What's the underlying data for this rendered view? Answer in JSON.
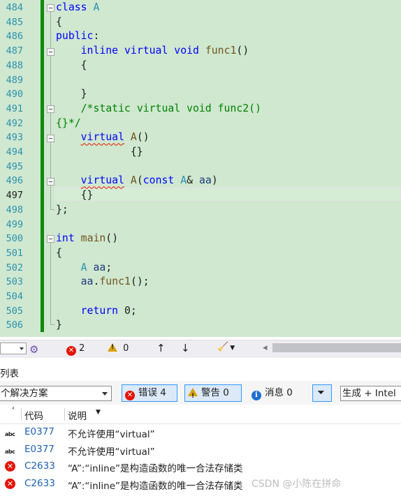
{
  "editor": {
    "line_numbers": [
      "484",
      "485",
      "486",
      "487",
      "488",
      "489",
      "490",
      "491",
      "492",
      "493",
      "494",
      "495",
      "496",
      "497",
      "498",
      "499",
      "500",
      "501",
      "502",
      "503",
      "504",
      "505",
      "506"
    ],
    "lines": [
      [
        {
          "t": "class",
          "c": "kw"
        },
        {
          "t": " "
        },
        {
          "t": "A",
          "c": "ty"
        }
      ],
      [
        {
          "t": "{"
        }
      ],
      [
        {
          "t": "public",
          "c": "kw"
        },
        {
          "t": ":"
        }
      ],
      [
        {
          "t": "    "
        },
        {
          "t": "inline",
          "c": "kw"
        },
        {
          "t": " "
        },
        {
          "t": "virtual",
          "c": "kw"
        },
        {
          "t": " "
        },
        {
          "t": "void",
          "c": "kw"
        },
        {
          "t": " "
        },
        {
          "t": "func1",
          "c": "fn"
        },
        {
          "t": "()"
        }
      ],
      [
        {
          "t": "    {"
        }
      ],
      [
        {
          "t": ""
        }
      ],
      [
        {
          "t": "    }"
        }
      ],
      [
        {
          "t": "    "
        },
        {
          "t": "/*static virtual void func2()",
          "c": "cm"
        }
      ],
      [
        {
          "t": "{}*/",
          "c": "cm"
        }
      ],
      [
        {
          "t": "    "
        },
        {
          "t": "virtual",
          "c": "kw squig"
        },
        {
          "t": " "
        },
        {
          "t": "A",
          "c": "fn"
        },
        {
          "t": "()"
        }
      ],
      [
        {
          "t": "            {}"
        }
      ],
      [
        {
          "t": ""
        }
      ],
      [
        {
          "t": "    "
        },
        {
          "t": "virtual",
          "c": "kw squig"
        },
        {
          "t": " "
        },
        {
          "t": "A",
          "c": "fn"
        },
        {
          "t": "("
        },
        {
          "t": "const",
          "c": "kw"
        },
        {
          "t": " "
        },
        {
          "t": "A",
          "c": "ty"
        },
        {
          "t": "& "
        },
        {
          "t": "aa",
          "c": "id"
        },
        {
          "t": ")"
        }
      ],
      [
        {
          "t": "    {}"
        }
      ],
      [
        {
          "t": "};"
        }
      ],
      [
        {
          "t": ""
        }
      ],
      [
        {
          "t": "int",
          "c": "kw"
        },
        {
          "t": " "
        },
        {
          "t": "main",
          "c": "fn"
        },
        {
          "t": "()"
        }
      ],
      [
        {
          "t": "{"
        }
      ],
      [
        {
          "t": "    "
        },
        {
          "t": "A",
          "c": "ty"
        },
        {
          "t": " "
        },
        {
          "t": "aa",
          "c": "id"
        },
        {
          "t": ";"
        }
      ],
      [
        {
          "t": "    "
        },
        {
          "t": "aa",
          "c": "id"
        },
        {
          "t": "."
        },
        {
          "t": "func1",
          "c": "fn"
        },
        {
          "t": "();"
        }
      ],
      [
        {
          "t": ""
        }
      ],
      [
        {
          "t": "    "
        },
        {
          "t": "return",
          "c": "kw"
        },
        {
          "t": " 0;"
        }
      ],
      [
        {
          "t": "}"
        }
      ]
    ]
  },
  "status_strip": {
    "error_count": "2",
    "warning_count": "0",
    "up_arrow": "↑",
    "down_arrow": "↓",
    "brush_icon": "🧹",
    "left_arrow": "◂"
  },
  "error_list": {
    "title": "列表",
    "scope": "个解决方案",
    "errors_label": "错误 4",
    "warnings_label": "警告 0",
    "messages_label": "消息 0",
    "build_filter": "生成 + Intel",
    "columns": {
      "code": "代码",
      "description": "说明"
    },
    "rows": [
      {
        "icon": "spell-check-icon",
        "code": "E0377",
        "description": "不允许使用“virtual”"
      },
      {
        "icon": "spell-check-icon",
        "code": "E0377",
        "description": "不允许使用“virtual”"
      },
      {
        "icon": "error-icon",
        "code": "C2633",
        "description": "“A”:“inline”是构造函数的唯一合法存储类"
      },
      {
        "icon": "error-icon",
        "code": "C2633",
        "description": "“A”:“inline”是构造函数的唯一合法存储类"
      }
    ]
  },
  "watermark": "CSDN @​​小陈在拼命​​",
  "colors": {
    "editor_bg": "#cfe8cf",
    "change_bar": "#108a10",
    "keyword": "#0000ff",
    "type": "#2b91af",
    "error": "#e51400",
    "link": "#1a5fb4"
  }
}
